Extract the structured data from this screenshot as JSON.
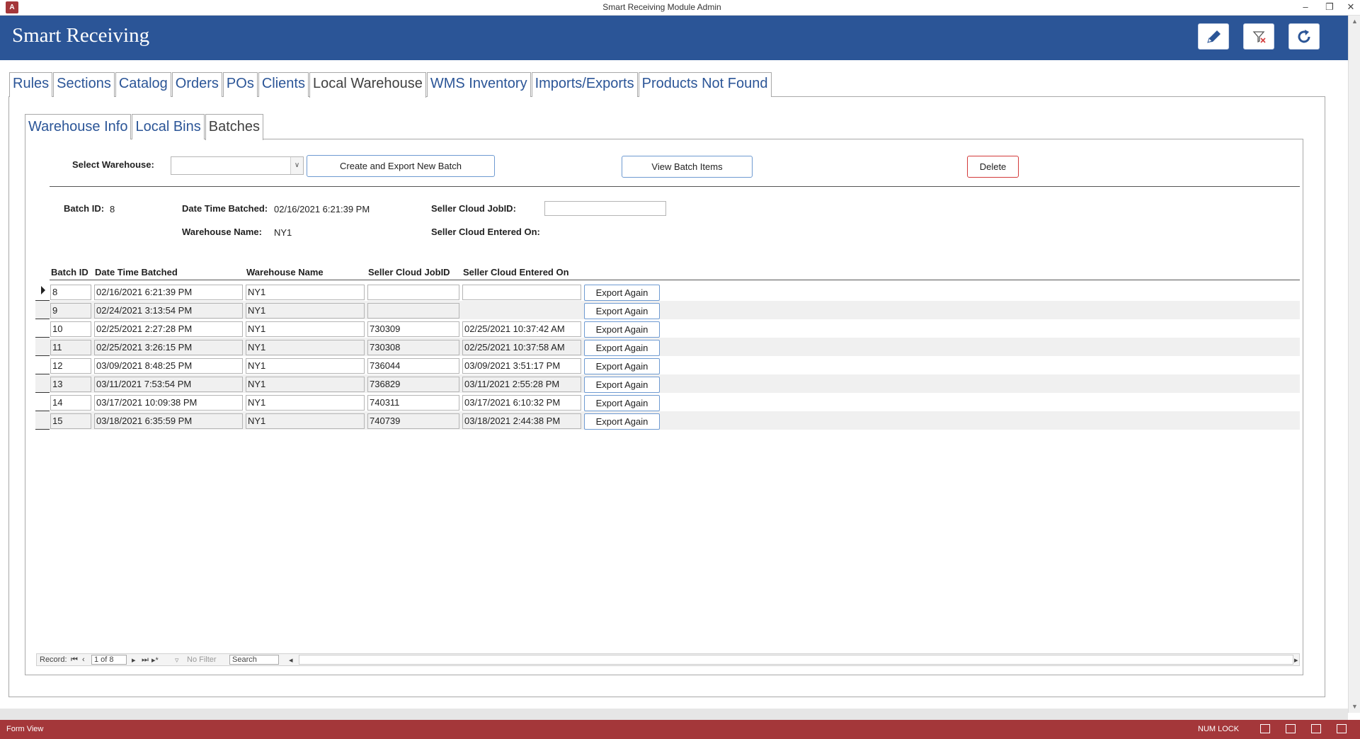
{
  "window": {
    "title": "Smart Receiving Module Admin",
    "app_icon": "A"
  },
  "header": {
    "title": "Smart Receiving",
    "buttons": [
      {
        "name": "edit-button",
        "icon": "pencil-icon"
      },
      {
        "name": "clear-filter-button",
        "icon": "filter-clear-icon"
      },
      {
        "name": "refresh-button",
        "icon": "refresh-icon"
      }
    ]
  },
  "main_tabs": [
    "Rules",
    "Sections",
    "Catalog",
    "Orders",
    "POs",
    "Clients",
    "Local Warehouse",
    "WMS Inventory",
    "Imports/Exports",
    "Products Not Found"
  ],
  "main_tabs_active": "Local Warehouse",
  "sub_tabs": [
    "Warehouse Info",
    "Local Bins",
    "Batches"
  ],
  "sub_tabs_active": "Batches",
  "form": {
    "select_warehouse_label": "Select Warehouse:",
    "select_warehouse_value": "",
    "create_button": "Create and Export New Batch",
    "view_button": "View Batch Items",
    "delete_button": "Delete",
    "batch_id_label": "Batch ID:",
    "batch_id_value": "8",
    "date_label": "Date Time Batched:",
    "date_value": "02/16/2021 6:21:39 PM",
    "warehouse_label": "Warehouse Name:",
    "warehouse_value": "NY1",
    "jobid_label": "Seller Cloud JobID:",
    "jobid_value": "",
    "entered_label": "Seller Cloud Entered On:",
    "entered_value": ""
  },
  "table": {
    "columns": [
      "Batch ID",
      "Date Time Batched",
      "Warehouse Name",
      "Seller Cloud JobID",
      "Seller Cloud Entered On"
    ],
    "action_label": "Export Again",
    "rows": [
      {
        "id": "8",
        "date": "02/16/2021 6:21:39 PM",
        "warehouse": "NY1",
        "jobid": "",
        "entered": ""
      },
      {
        "id": "9",
        "date": "02/24/2021 3:13:54 PM",
        "warehouse": "NY1",
        "jobid": "",
        "entered": ""
      },
      {
        "id": "10",
        "date": "02/25/2021 2:27:28 PM",
        "warehouse": "NY1",
        "jobid": "730309",
        "entered": "02/25/2021 10:37:42 AM"
      },
      {
        "id": "11",
        "date": "02/25/2021 3:26:15 PM",
        "warehouse": "NY1",
        "jobid": "730308",
        "entered": "02/25/2021 10:37:58 AM"
      },
      {
        "id": "12",
        "date": "03/09/2021 8:48:25 PM",
        "warehouse": "NY1",
        "jobid": "736044",
        "entered": "03/09/2021 3:51:17 PM"
      },
      {
        "id": "13",
        "date": "03/11/2021 7:53:54 PM",
        "warehouse": "NY1",
        "jobid": "736829",
        "entered": "03/11/2021 2:55:28 PM"
      },
      {
        "id": "14",
        "date": "03/17/2021 10:09:38 PM",
        "warehouse": "NY1",
        "jobid": "740311",
        "entered": "03/17/2021 6:10:32 PM"
      },
      {
        "id": "15",
        "date": "03/18/2021 6:35:59 PM",
        "warehouse": "NY1",
        "jobid": "740739",
        "entered": "03/18/2021 2:44:38 PM"
      }
    ]
  },
  "navigation": {
    "record_label": "Record:",
    "record_value": "1 of 8",
    "filter_label": "No Filter",
    "search_label": "Search"
  },
  "status": {
    "view": "Form View",
    "num_lock": "NUM LOCK"
  },
  "colors": {
    "header_bg": "#2b5597",
    "status_bg": "#a4373a",
    "tab_text": "#2b5597"
  }
}
